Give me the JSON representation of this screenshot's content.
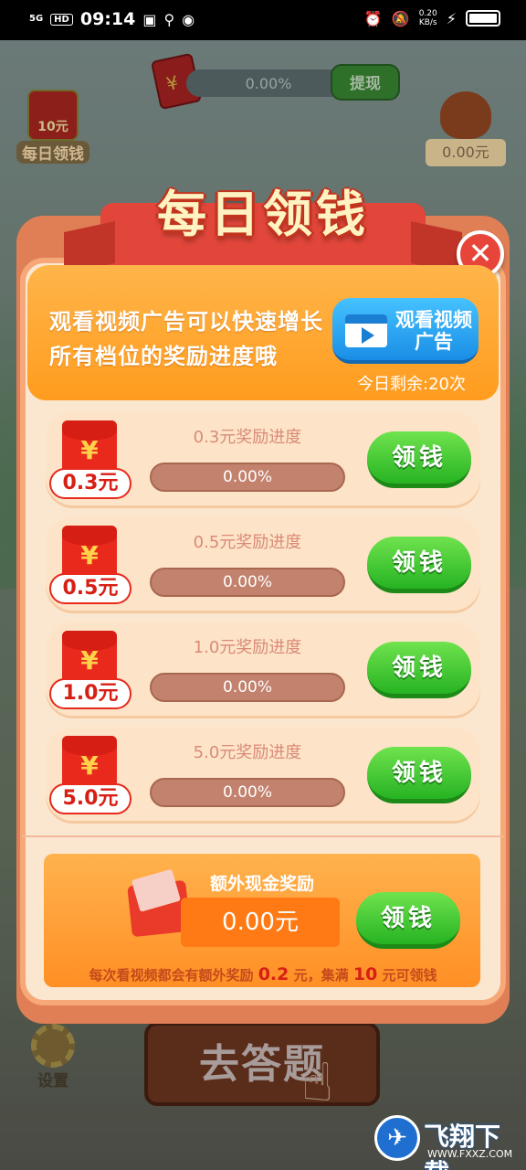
{
  "status_bar": {
    "signal": "5G",
    "hd": "HD",
    "time": "09:14",
    "net_speed": "0.20",
    "net_unit": "KB/s"
  },
  "background": {
    "progress_pct": "0.00%",
    "withdraw_label": "提现",
    "daily_icon_amount": "10元",
    "daily_icon_label": "每日领钱",
    "bag_value": "0.00元",
    "settings_label": "设置",
    "answer_button": "去答题"
  },
  "dialog": {
    "title": "每日领钱",
    "close_symbol": "✕",
    "promo": {
      "line1": "观看视频广告可以快速增长",
      "line2": "所有档位的奖励进度哦",
      "watch_button": "观看视频广告",
      "remaining": "今日剩余:20次"
    },
    "tiers": [
      {
        "amount": "0.3元",
        "title": "0.3元奖励进度",
        "progress": "0.00%",
        "button": "领钱"
      },
      {
        "amount": "0.5元",
        "title": "0.5元奖励进度",
        "progress": "0.00%",
        "button": "领钱"
      },
      {
        "amount": "1.0元",
        "title": "1.0元奖励进度",
        "progress": "0.00%",
        "button": "领钱"
      },
      {
        "amount": "5.0元",
        "title": "5.0元奖励进度",
        "progress": "0.00%",
        "button": "领钱"
      }
    ],
    "extra": {
      "title": "额外现金奖励",
      "value": "0.00元",
      "button": "领钱",
      "note_prefix": "每次看视频都会有额外奖励",
      "note_amount": "0.2",
      "note_middle": "元，集满",
      "note_target": "10",
      "note_suffix": "元可领钱"
    }
  },
  "watermark": {
    "name": "飞翔下载",
    "url": "WWW.FXXZ.COM"
  }
}
